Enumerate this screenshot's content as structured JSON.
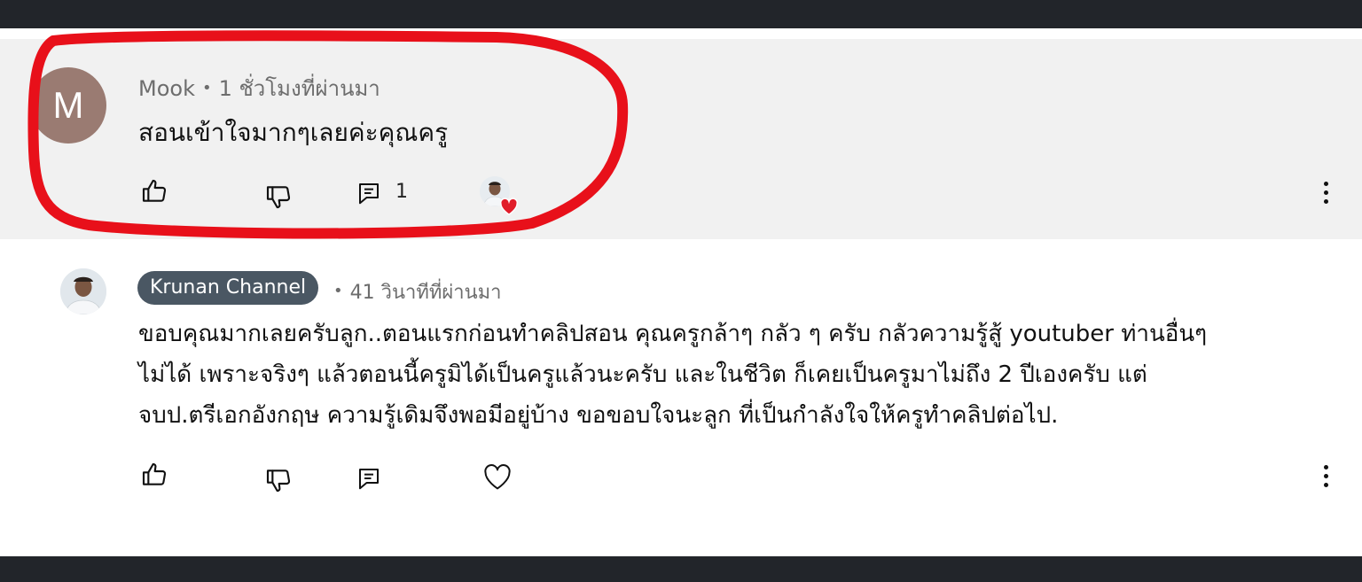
{
  "comments": [
    {
      "author": "Mook",
      "avatar_letter": "M",
      "time": "1 ชั่วโมงที่ผ่านมา",
      "text": "สอนเข้าใจมากๆเลยค่ะคุณครู",
      "reply_count": "1",
      "hearted_by_creator": true,
      "highlighted": true
    },
    {
      "author": "Krunan Channel",
      "is_creator_badge": true,
      "time": "41 วินาทีที่ผ่านมา",
      "text_lines": [
        "ขอบคุณมากเลยครับลูก..ตอนแรกก่อนทำคลิปสอน คุณครูกล้าๆ กลัว ๆ ครับ กลัวความรู้สู้ youtuber ท่านอื่นๆ",
        "ไม่ได้ เพราะจริงๆ แล้วตอนนี้ครูมิได้เป็นครูแล้วนะครับ และในชีวิต ก็เคยเป็นครูมาไม่ถึง 2 ปีเองครับ แต่",
        "จบป.ตรีเอกอังกฤษ ความรู้เดิมจึงพอมีอยู่บ้าง ขอขอบใจนะลูก ที่เป็นกำลังใจให้ครูทำคลิปต่อไป."
      ]
    }
  ],
  "icons": {
    "like": "thumbs-up-icon",
    "dislike": "thumbs-down-icon",
    "reply": "reply-icon",
    "heart": "heart-icon",
    "more": "more-vertical-icon"
  },
  "colors": {
    "highlight_ring": "#e8101a",
    "highlight_bg": "#f1f1f1",
    "creator_badge": "#4a5763",
    "heart": "#e11d2a"
  }
}
